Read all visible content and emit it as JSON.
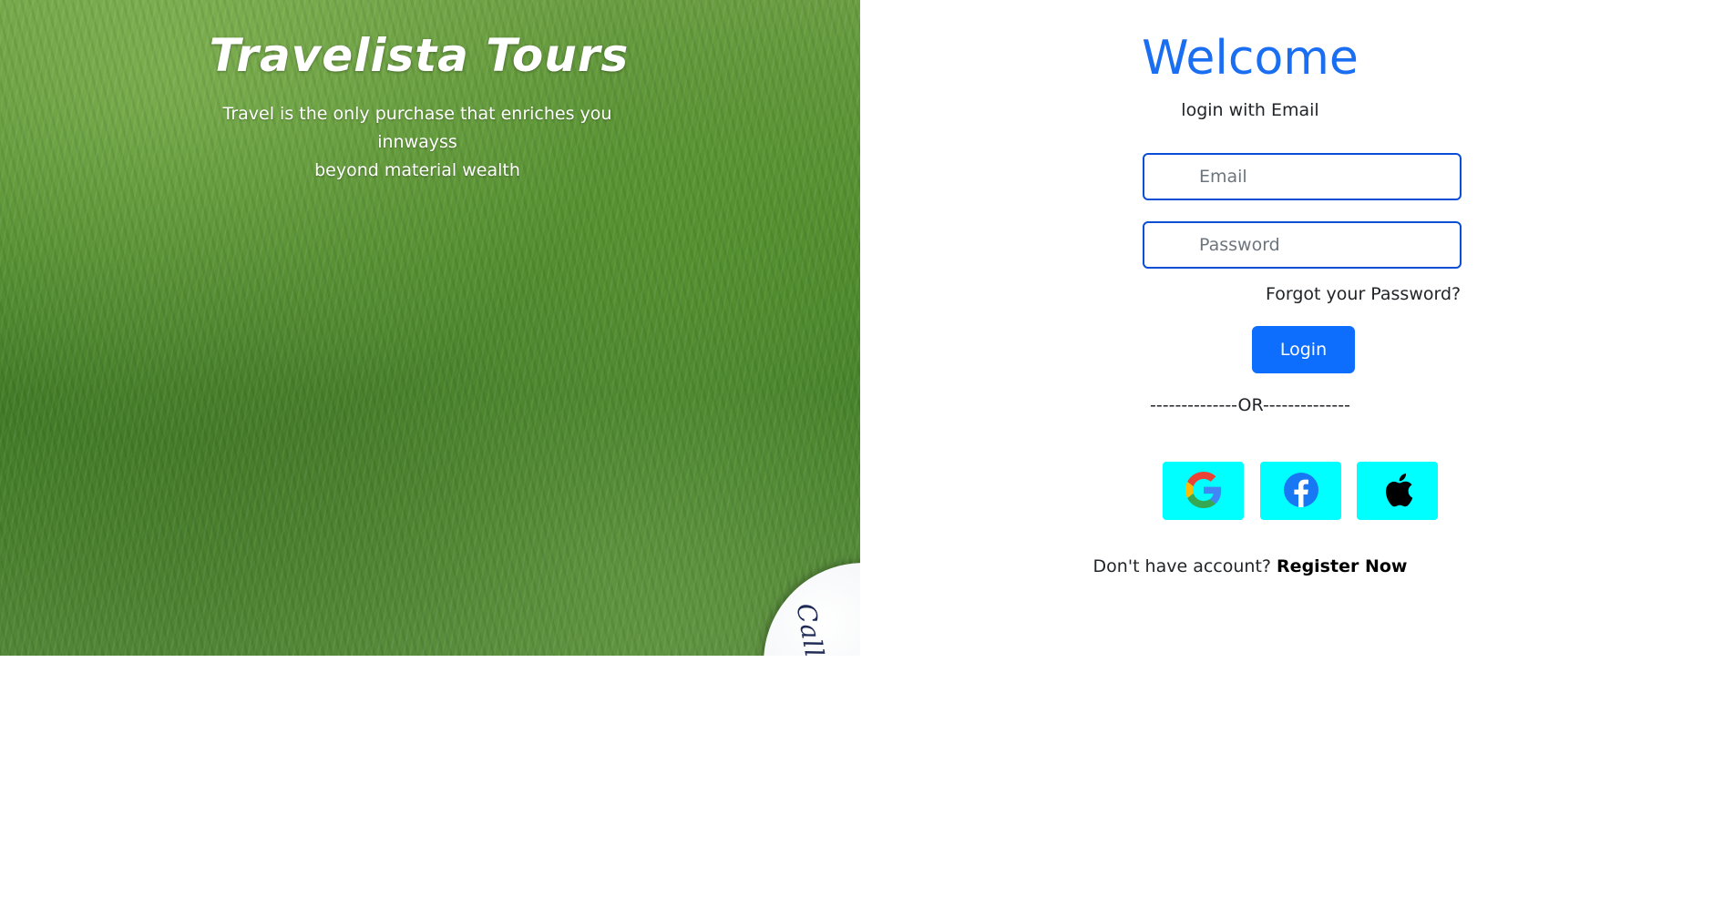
{
  "hero": {
    "title": "Travelista Tours",
    "subtitle_line1": "Travel is the only purchase that enriches you innwayss",
    "subtitle_line2": "beyond material wealth",
    "golf_ball_text": "Call"
  },
  "login": {
    "heading": "Welcome",
    "subheading": "login with Email",
    "email_placeholder": "Email",
    "email_value": "",
    "password_placeholder": "Password",
    "password_value": "",
    "forgot_label": "Forgot your Password?",
    "login_label": "Login",
    "or_separator": "--------------OR--------------",
    "social": [
      {
        "name": "google-icon"
      },
      {
        "name": "facebook-icon"
      },
      {
        "name": "apple-icon"
      }
    ],
    "register_prompt": "Don't have account?",
    "register_link": "Register Now"
  },
  "colors": {
    "accent": "#0d6efd",
    "heading": "#1a6ef2",
    "social_bg": "#00ffff",
    "input_border": "#0a4ed6"
  }
}
